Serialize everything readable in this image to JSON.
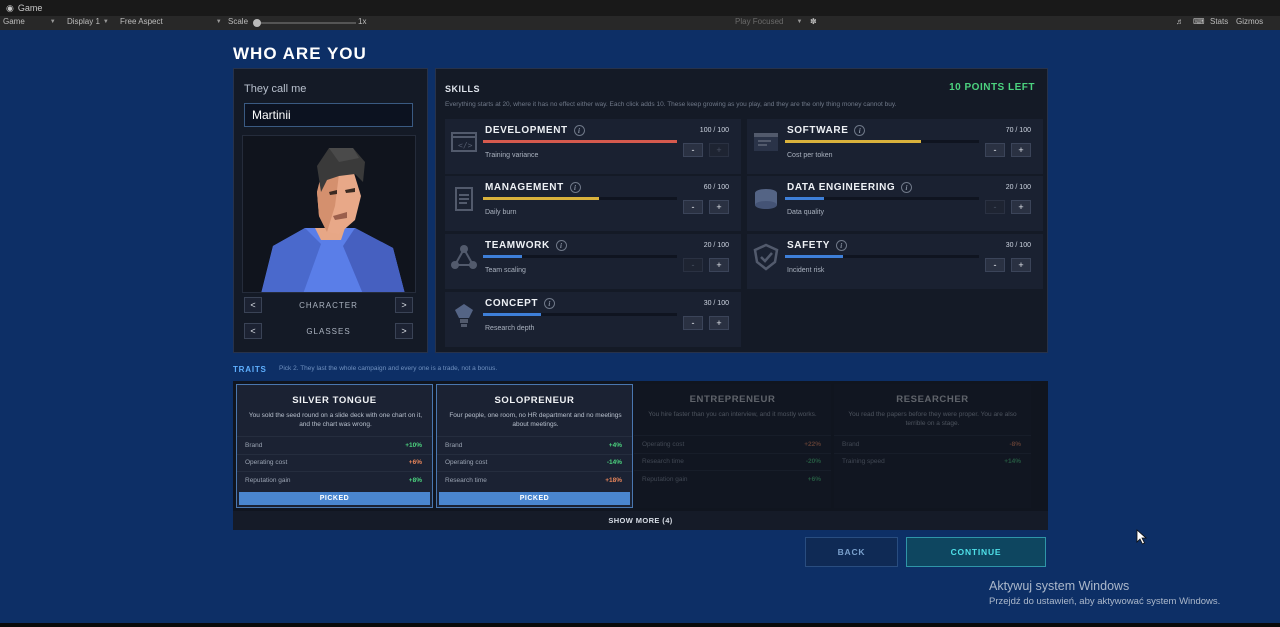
{
  "editor": {
    "window_title": "Game",
    "toolbar": {
      "view": "Game",
      "display": "Display 1",
      "aspect": "Free Aspect",
      "scale_label": "Scale",
      "scale_value": "1x",
      "play_mode": "Play Focused",
      "stats": "Stats",
      "gizmos": "Gizmos"
    }
  },
  "page": {
    "title": "WHO ARE YOU"
  },
  "character": {
    "name_label": "They call me",
    "name_value": "Martinii",
    "selectors": [
      {
        "label": "CHARACTER",
        "prev": "<",
        "next": ">"
      },
      {
        "label": "GLASSES",
        "prev": "<",
        "next": ">"
      }
    ]
  },
  "skills": {
    "title": "SKILLS",
    "points_left": "10 POINTS LEFT",
    "description": "Everything starts at 20, where it has no effect either way. Each click adds 10. These keep growing as you play, and they are the only thing money cannot buy.",
    "items": [
      {
        "name": "DEVELOPMENT",
        "value": "100 / 100",
        "subtitle": "Training variance",
        "fraction": 1.0,
        "color": "#d65a4e",
        "icon": "code-window-icon",
        "minus_enabled": true,
        "plus_enabled": false
      },
      {
        "name": "SOFTWARE",
        "value": "70 / 100",
        "subtitle": "Cost per token",
        "fraction": 0.7,
        "color": "#d9b23c",
        "icon": "browser-icon",
        "minus_enabled": true,
        "plus_enabled": true
      },
      {
        "name": "MANAGEMENT",
        "value": "60 / 100",
        "subtitle": "Daily burn",
        "fraction": 0.6,
        "color": "#d9b23c",
        "icon": "clipboard-icon",
        "minus_enabled": true,
        "plus_enabled": true
      },
      {
        "name": "DATA ENGINEERING",
        "value": "20 / 100",
        "subtitle": "Data quality",
        "fraction": 0.2,
        "color": "#3e7fd8",
        "icon": "database-icon",
        "minus_enabled": false,
        "plus_enabled": true
      },
      {
        "name": "TEAMWORK",
        "value": "20 / 100",
        "subtitle": "Team scaling",
        "fraction": 0.2,
        "color": "#3e7fd8",
        "icon": "network-icon",
        "minus_enabled": false,
        "plus_enabled": true
      },
      {
        "name": "SAFETY",
        "value": "30 / 100",
        "subtitle": "Incident risk",
        "fraction": 0.3,
        "color": "#3e7fd8",
        "icon": "shield-icon",
        "minus_enabled": true,
        "plus_enabled": true
      },
      {
        "name": "CONCEPT",
        "value": "30 / 100",
        "subtitle": "Research depth",
        "fraction": 0.3,
        "color": "#3e7fd8",
        "icon": "lightbulb-icon",
        "minus_enabled": true,
        "plus_enabled": true
      }
    ],
    "minus": "-",
    "plus": "+",
    "info": "i"
  },
  "traits": {
    "title": "TRAITS",
    "description": "Pick 2. They last the whole campaign and every one is a trade, not a bonus.",
    "cards": [
      {
        "name": "SILVER TONGUE",
        "description": "You sold the seed round on a slide deck with one chart on it, and the chart was wrong.",
        "picked": true,
        "stats": [
          {
            "label": "Brand",
            "value": "+10%",
            "positive": true
          },
          {
            "label": "Operating cost",
            "value": "+6%",
            "positive": false
          },
          {
            "label": "Reputation gain",
            "value": "+8%",
            "positive": true
          }
        ]
      },
      {
        "name": "SOLOPRENEUR",
        "description": "Four people, one room, no HR department and no meetings about meetings.",
        "picked": true,
        "stats": [
          {
            "label": "Brand",
            "value": "+4%",
            "positive": true
          },
          {
            "label": "Operating cost",
            "value": "-14%",
            "positive": true
          },
          {
            "label": "Research time",
            "value": "+18%",
            "positive": false
          }
        ]
      },
      {
        "name": "ENTREPRENEUR",
        "description": "You hire faster than you can interview, and it mostly works.",
        "picked": false,
        "stats": [
          {
            "label": "Operating cost",
            "value": "+22%",
            "positive": false
          },
          {
            "label": "Research time",
            "value": "-20%",
            "positive": true
          },
          {
            "label": "Reputation gain",
            "value": "+6%",
            "positive": true
          }
        ]
      },
      {
        "name": "RESEARCHER",
        "description": "You read the papers before they were proper. You are also terrible on a stage.",
        "picked": false,
        "stats": [
          {
            "label": "Brand",
            "value": "-8%",
            "positive": false
          },
          {
            "label": "Training speed",
            "value": "+14%",
            "positive": true
          }
        ]
      }
    ],
    "picked_label": "PICKED",
    "show_more": "SHOW MORE (4)"
  },
  "actions": {
    "back": "BACK",
    "continue": "CONTINUE"
  },
  "watermark": {
    "title": "Aktywuj system Windows",
    "subtitle": "Przejdź do ustawień, aby aktywować system Windows."
  }
}
